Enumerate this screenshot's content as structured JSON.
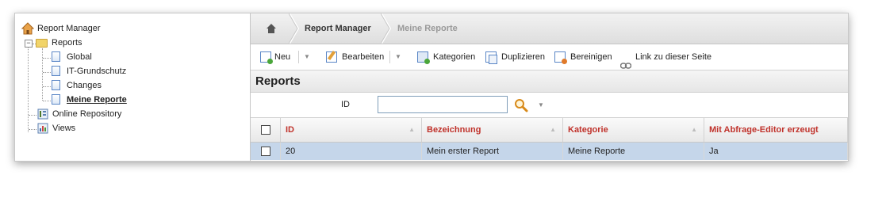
{
  "tree": {
    "root_label": "Report Manager",
    "reports_label": "Reports",
    "children": [
      "Global",
      "IT-Grundschutz",
      "Changes",
      "Meine Reporte"
    ],
    "online_repository_label": "Online Repository",
    "views_label": "Views"
  },
  "breadcrumb": {
    "home_icon": "home-icon",
    "items": [
      "Report Manager",
      "Meine Reporte"
    ]
  },
  "toolbar": {
    "new_label": "Neu",
    "edit_label": "Bearbeiten",
    "categories_label": "Kategorien",
    "duplicate_label": "Duplizieren",
    "cleanup_label": "Bereinigen",
    "link_label": "Link zu dieser Seite"
  },
  "panel": {
    "title": "Reports"
  },
  "filter": {
    "label": "ID",
    "value": ""
  },
  "grid": {
    "columns": [
      "ID",
      "Bezeichnung",
      "Kategorie",
      "Mit Abfrage-Editor erzeugt"
    ],
    "rows": [
      {
        "id": "20",
        "name": "Mein erster Report",
        "category": "Meine Reporte",
        "editor": "Ja"
      }
    ]
  },
  "colors": {
    "header_text": "#c0322b",
    "selected_row": "#c5d6ea"
  }
}
